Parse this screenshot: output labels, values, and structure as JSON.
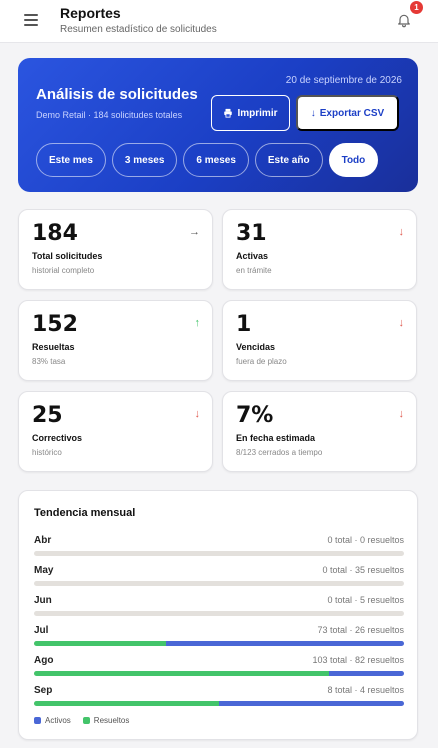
{
  "header": {
    "title": "Reportes",
    "subtitle": "Resumen estadístico de solicitudes",
    "notification_count": "1"
  },
  "hero": {
    "date": "20 de septiembre de 2026",
    "title": "Análisis de solicitudes",
    "subtitle": "Demo Retail · 184 solicitudes totales",
    "print_label": "Imprimir",
    "export_label": "Exportar CSV",
    "chips": [
      {
        "label": "Este mes",
        "active": false
      },
      {
        "label": "3 meses",
        "active": false
      },
      {
        "label": "6 meses",
        "active": false
      },
      {
        "label": "Este año",
        "active": false
      },
      {
        "label": "Todo",
        "active": true
      }
    ]
  },
  "stats": [
    {
      "value": "184",
      "label": "Total solicitudes",
      "desc": "historial completo",
      "trend": "neutral"
    },
    {
      "value": "31",
      "label": "Activas",
      "desc": "en trámite",
      "trend": "down"
    },
    {
      "value": "152",
      "label": "Resueltas",
      "desc": "83% tasa",
      "trend": "up"
    },
    {
      "value": "1",
      "label": "Vencidas",
      "desc": "fuera de plazo",
      "trend": "down"
    },
    {
      "value": "25",
      "label": "Correctivos",
      "desc": "histórico",
      "trend": "down"
    },
    {
      "value": "7%",
      "label": "En fecha estimada",
      "desc": "8/123 cerrados a tiempo",
      "trend": "down"
    }
  ],
  "trend": {
    "title": "Tendencia mensual",
    "months": [
      {
        "month": "Abr",
        "info": "0 total · 0 resueltos",
        "total": 0,
        "resolved": 0
      },
      {
        "month": "May",
        "info": "0 total · 35 resueltos",
        "total": 0,
        "resolved": 35
      },
      {
        "month": "Jun",
        "info": "0 total · 5 resueltos",
        "total": 0,
        "resolved": 5
      },
      {
        "month": "Jul",
        "info": "73 total · 26 resueltos",
        "total": 73,
        "resolved": 26
      },
      {
        "month": "Ago",
        "info": "103 total · 82 resueltos",
        "total": 103,
        "resolved": 82
      },
      {
        "month": "Sep",
        "info": "8 total · 4 resueltos",
        "total": 8,
        "resolved": 4
      }
    ],
    "legend": [
      {
        "label": "Activos",
        "color": "#4a67d6"
      },
      {
        "label": "Resueltos",
        "color": "#43c46a"
      }
    ]
  },
  "colors": {
    "accent": "#1c3fc6",
    "up": "#43c46a",
    "down": "#e05a4f",
    "neutral": "#555555"
  }
}
